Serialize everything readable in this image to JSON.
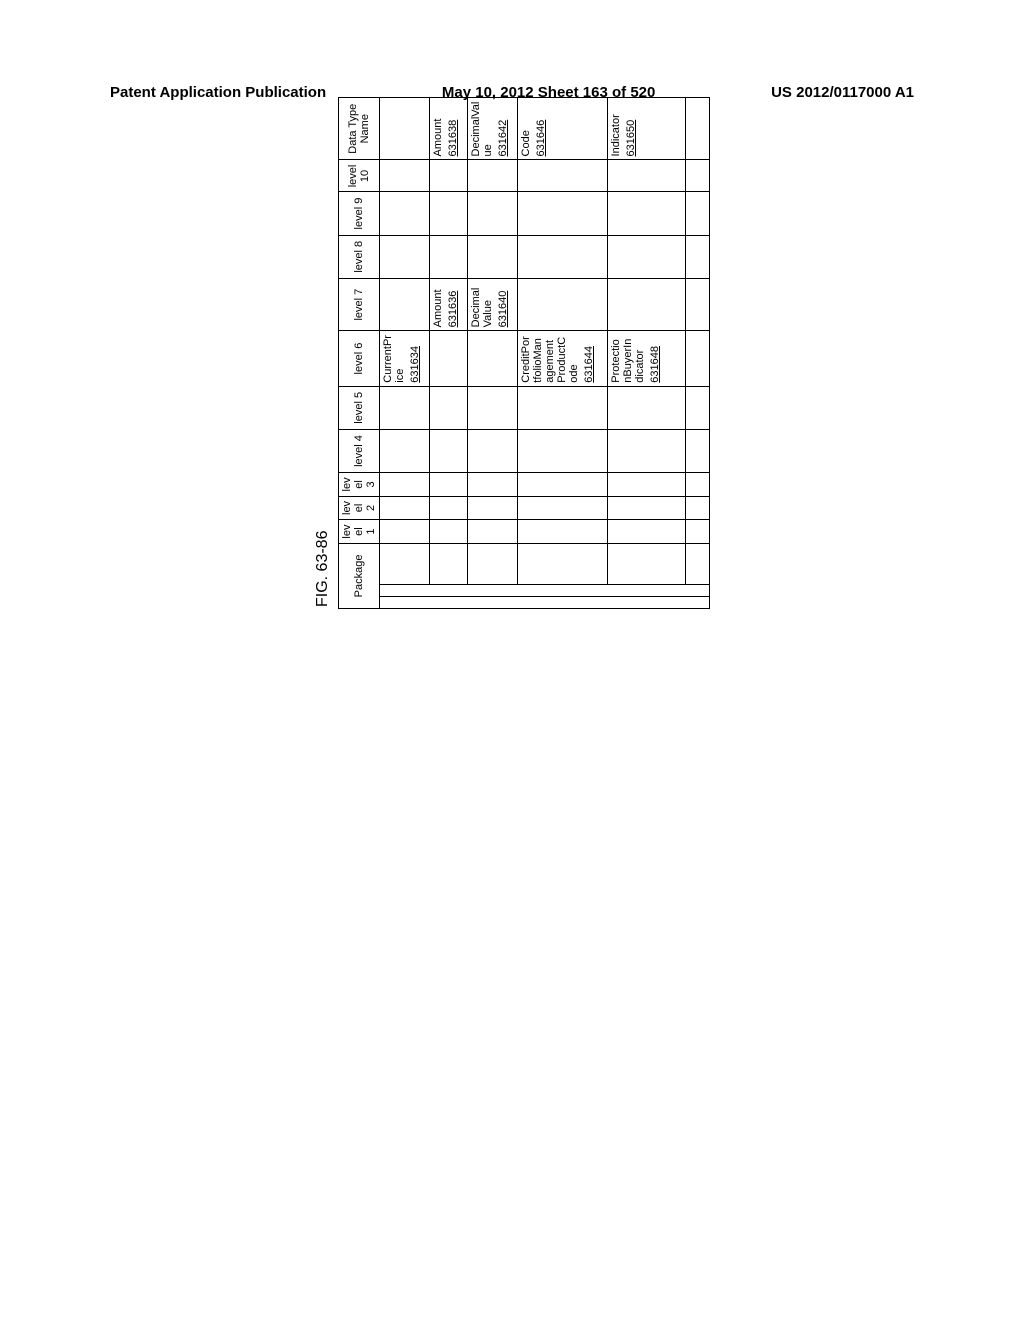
{
  "header": {
    "left": "Patent Application Publication",
    "center": "May 10, 2012  Sheet 163 of 520",
    "right": "US 2012/0117000 A1"
  },
  "figure_label": "FIG. 63-86",
  "columns": {
    "package": "Package",
    "l1": "level 1",
    "l2": "level 2",
    "l3": "level 3",
    "l4": "level 4",
    "l5": "level 5",
    "l6": "level 6",
    "l7": "level 7",
    "l8": "level 8",
    "l9": "level 9",
    "l10": "level 10",
    "dtn": "Data Type Name"
  },
  "rows": {
    "r1": {
      "l6": "CurrentPrice",
      "l6ref": "631634"
    },
    "r2": {
      "l7": "Amount",
      "l7ref": "631636",
      "dtn": "Amount",
      "dtnref": "631638"
    },
    "r3": {
      "l7": "DecimalValue",
      "l7ref": "631640",
      "dtn": "DecimalValue",
      "dtnref": "631642"
    },
    "r4": {
      "l6": "CreditPortfolioManagementProductCode",
      "l6ref": "631644",
      "dtn": "Code",
      "dtnref": "631646"
    },
    "r5": {
      "l6": "ProtectionBuyerIndicator",
      "l6ref": "631648",
      "dtn": "Indicator",
      "dtnref": "631650"
    }
  }
}
